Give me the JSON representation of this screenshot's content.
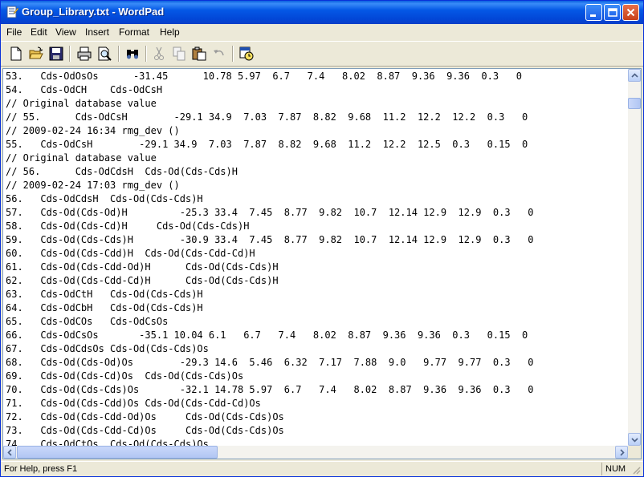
{
  "window": {
    "title": "Group_Library.txt - WordPad"
  },
  "menu": [
    {
      "label": "File"
    },
    {
      "label": "Edit"
    },
    {
      "label": "View"
    },
    {
      "label": "Insert"
    },
    {
      "label": "Format"
    },
    {
      "label": "Help"
    }
  ],
  "toolbar": {
    "buttons": [
      {
        "name": "new-icon"
      },
      {
        "name": "open-icon"
      },
      {
        "name": "save-icon"
      },
      {
        "name": "print-icon"
      },
      {
        "name": "print-preview-icon"
      },
      {
        "name": "find-icon"
      },
      {
        "name": "cut-icon"
      },
      {
        "name": "copy-icon"
      },
      {
        "name": "paste-icon"
      },
      {
        "name": "undo-icon"
      },
      {
        "name": "date-time-icon"
      }
    ]
  },
  "document": {
    "lines": [
      "53.   Cds-OdOsOs      -31.45      10.78 5.97  6.7   7.4   8.02  8.87  9.36  9.36  0.3   0",
      "54.   Cds-OdCH    Cds-OdCsH",
      "// Original database value",
      "// 55.      Cds-OdCsH        -29.1 34.9  7.03  7.87  8.82  9.68  11.2  12.2  12.2  0.3   0",
      "// 2009-02-24 16:34 rmg_dev ()",
      "55.   Cds-OdCsH        -29.1 34.9  7.03  7.87  8.82  9.68  11.2  12.2  12.5  0.3   0.15  0",
      "// Original database value",
      "// 56.      Cds-OdCdsH  Cds-Od(Cds-Cds)H",
      "// 2009-02-24 17:03 rmg_dev ()",
      "56.   Cds-OdCdsH  Cds-Od(Cds-Cds)H",
      "57.   Cds-Od(Cds-Od)H         -25.3 33.4  7.45  8.77  9.82  10.7  12.14 12.9  12.9  0.3   0",
      "58.   Cds-Od(Cds-Cd)H     Cds-Od(Cds-Cds)H",
      "59.   Cds-Od(Cds-Cds)H        -30.9 33.4  7.45  8.77  9.82  10.7  12.14 12.9  12.9  0.3   0",
      "60.   Cds-Od(Cds-Cdd)H  Cds-Od(Cds-Cdd-Cd)H",
      "61.   Cds-Od(Cds-Cdd-Od)H      Cds-Od(Cds-Cds)H",
      "62.   Cds-Od(Cds-Cdd-Cd)H      Cds-Od(Cds-Cds)H",
      "63.   Cds-OdCtH   Cds-Od(Cds-Cds)H",
      "64.   Cds-OdCbH   Cds-Od(Cds-Cds)H",
      "65.   Cds-OdCOs   Cds-OdCsOs",
      "66.   Cds-OdCsOs       -35.1 10.04 6.1   6.7   7.4   8.02  8.87  9.36  9.36  0.3   0.15  0",
      "67.   Cds-OdCdsOs Cds-Od(Cds-Cds)Os",
      "68.   Cds-Od(Cds-Od)Os        -29.3 14.6  5.46  6.32  7.17  7.88  9.0   9.77  9.77  0.3   0",
      "69.   Cds-Od(Cds-Cd)Os  Cds-Od(Cds-Cds)Os",
      "70.   Cds-Od(Cds-Cds)Os       -32.1 14.78 5.97  6.7   7.4   8.02  8.87  9.36  9.36  0.3   0",
      "71.   Cds-Od(Cds-Cdd)Os Cds-Od(Cds-Cdd-Cd)Os",
      "72.   Cds-Od(Cds-Cdd-Od)Os     Cds-Od(Cds-Cds)Os",
      "73.   Cds-Od(Cds-Cdd-Cd)Os     Cds-Od(Cds-Cds)Os",
      "74.   Cds-OdCtOs  Cds-Od(Cds-Cds)Os"
    ]
  },
  "status": {
    "help_text": "For Help, press F1",
    "num_indicator": "NUM"
  },
  "colors": {
    "titlebar": "#0458e6",
    "close_button": "#c8401a",
    "window_face": "#ece9d8",
    "editor_background": "#ffffff"
  }
}
